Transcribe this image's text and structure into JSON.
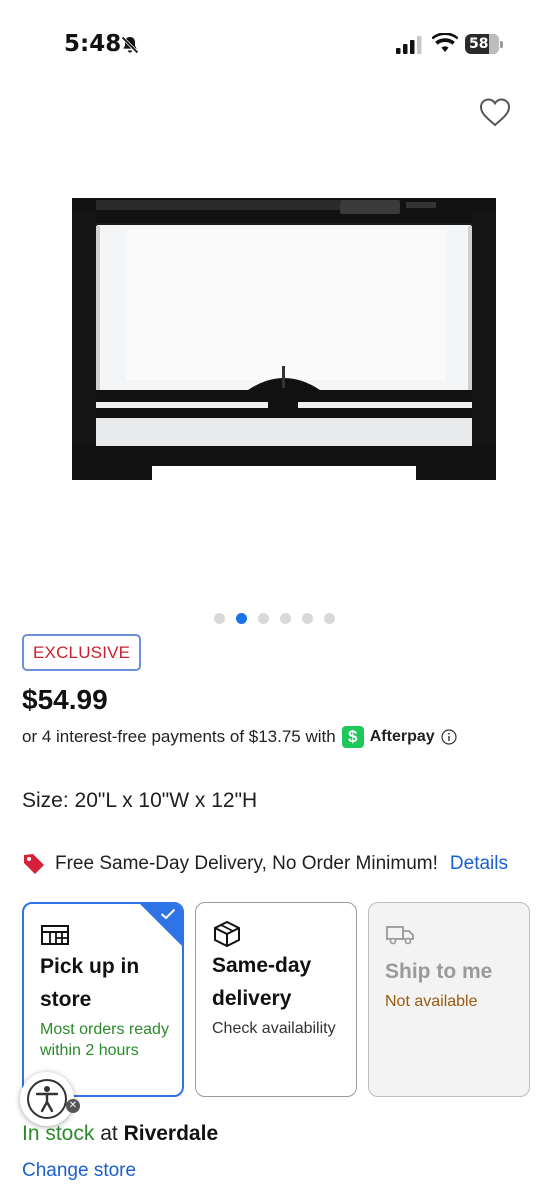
{
  "status_bar": {
    "time": "5:48",
    "battery": "58"
  },
  "product": {
    "image_icon": "reptile-terrarium-image",
    "carousel": {
      "count": 6,
      "active_index": 1
    },
    "badge": "EXCLUSIVE",
    "price": "$54.99",
    "installments": {
      "text": "or 4 interest-free payments of $13.75 with",
      "provider_logo": "$",
      "provider": "Afterpay"
    },
    "size": {
      "label": "Size:",
      "value": "20\"L x 10\"W x 12\"H"
    }
  },
  "promo": {
    "text": "Free Same-Day Delivery, No Order Minimum!",
    "link": "Details"
  },
  "fulfillment": {
    "pickup": {
      "title": "Pick up in store",
      "subtitle": "Most orders ready within 2 hours",
      "icon": "store-icon",
      "selected": true
    },
    "same_day": {
      "title": "Same-day delivery",
      "subtitle": "Check availability",
      "icon": "package-icon"
    },
    "ship": {
      "title": "Ship to me",
      "subtitle": "Not available",
      "icon": "truck-icon"
    }
  },
  "stock": {
    "status": "In stock",
    "at": "at",
    "store": "Riverdale",
    "change_store": "Change store"
  },
  "colors": {
    "accent_blue": "#2f74e6",
    "link_blue": "#1a5fcf",
    "exclusive_red": "#cc1f2f",
    "in_stock_green": "#2a8a2a",
    "not_available_brown": "#9a5a10",
    "afterpay_green": "#1ec85a"
  }
}
